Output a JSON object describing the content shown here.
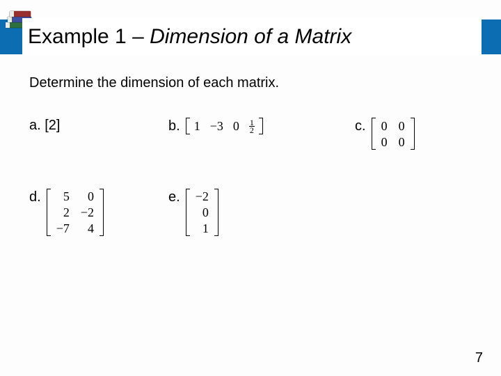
{
  "header": {
    "title_plain": "Example 1 – ",
    "title_italic": "Dimension of a Matrix"
  },
  "prompt": "Determine the dimension of each matrix.",
  "items": {
    "a": {
      "label": "a. [2]"
    },
    "b": {
      "label": "b.",
      "row": [
        "1",
        "−3",
        "0"
      ],
      "frac_num": "1",
      "frac_den": "2"
    },
    "c": {
      "label": "c.",
      "matrix": [
        [
          "0",
          "0"
        ],
        [
          "0",
          "0"
        ]
      ]
    },
    "d": {
      "label": "d.",
      "matrix": [
        [
          "5",
          "0"
        ],
        [
          "2",
          "−2"
        ],
        [
          "−7",
          "4"
        ]
      ]
    },
    "e": {
      "label": "e.",
      "matrix": [
        [
          "−2"
        ],
        [
          "0"
        ],
        [
          "1"
        ]
      ]
    }
  },
  "page_number": "7"
}
